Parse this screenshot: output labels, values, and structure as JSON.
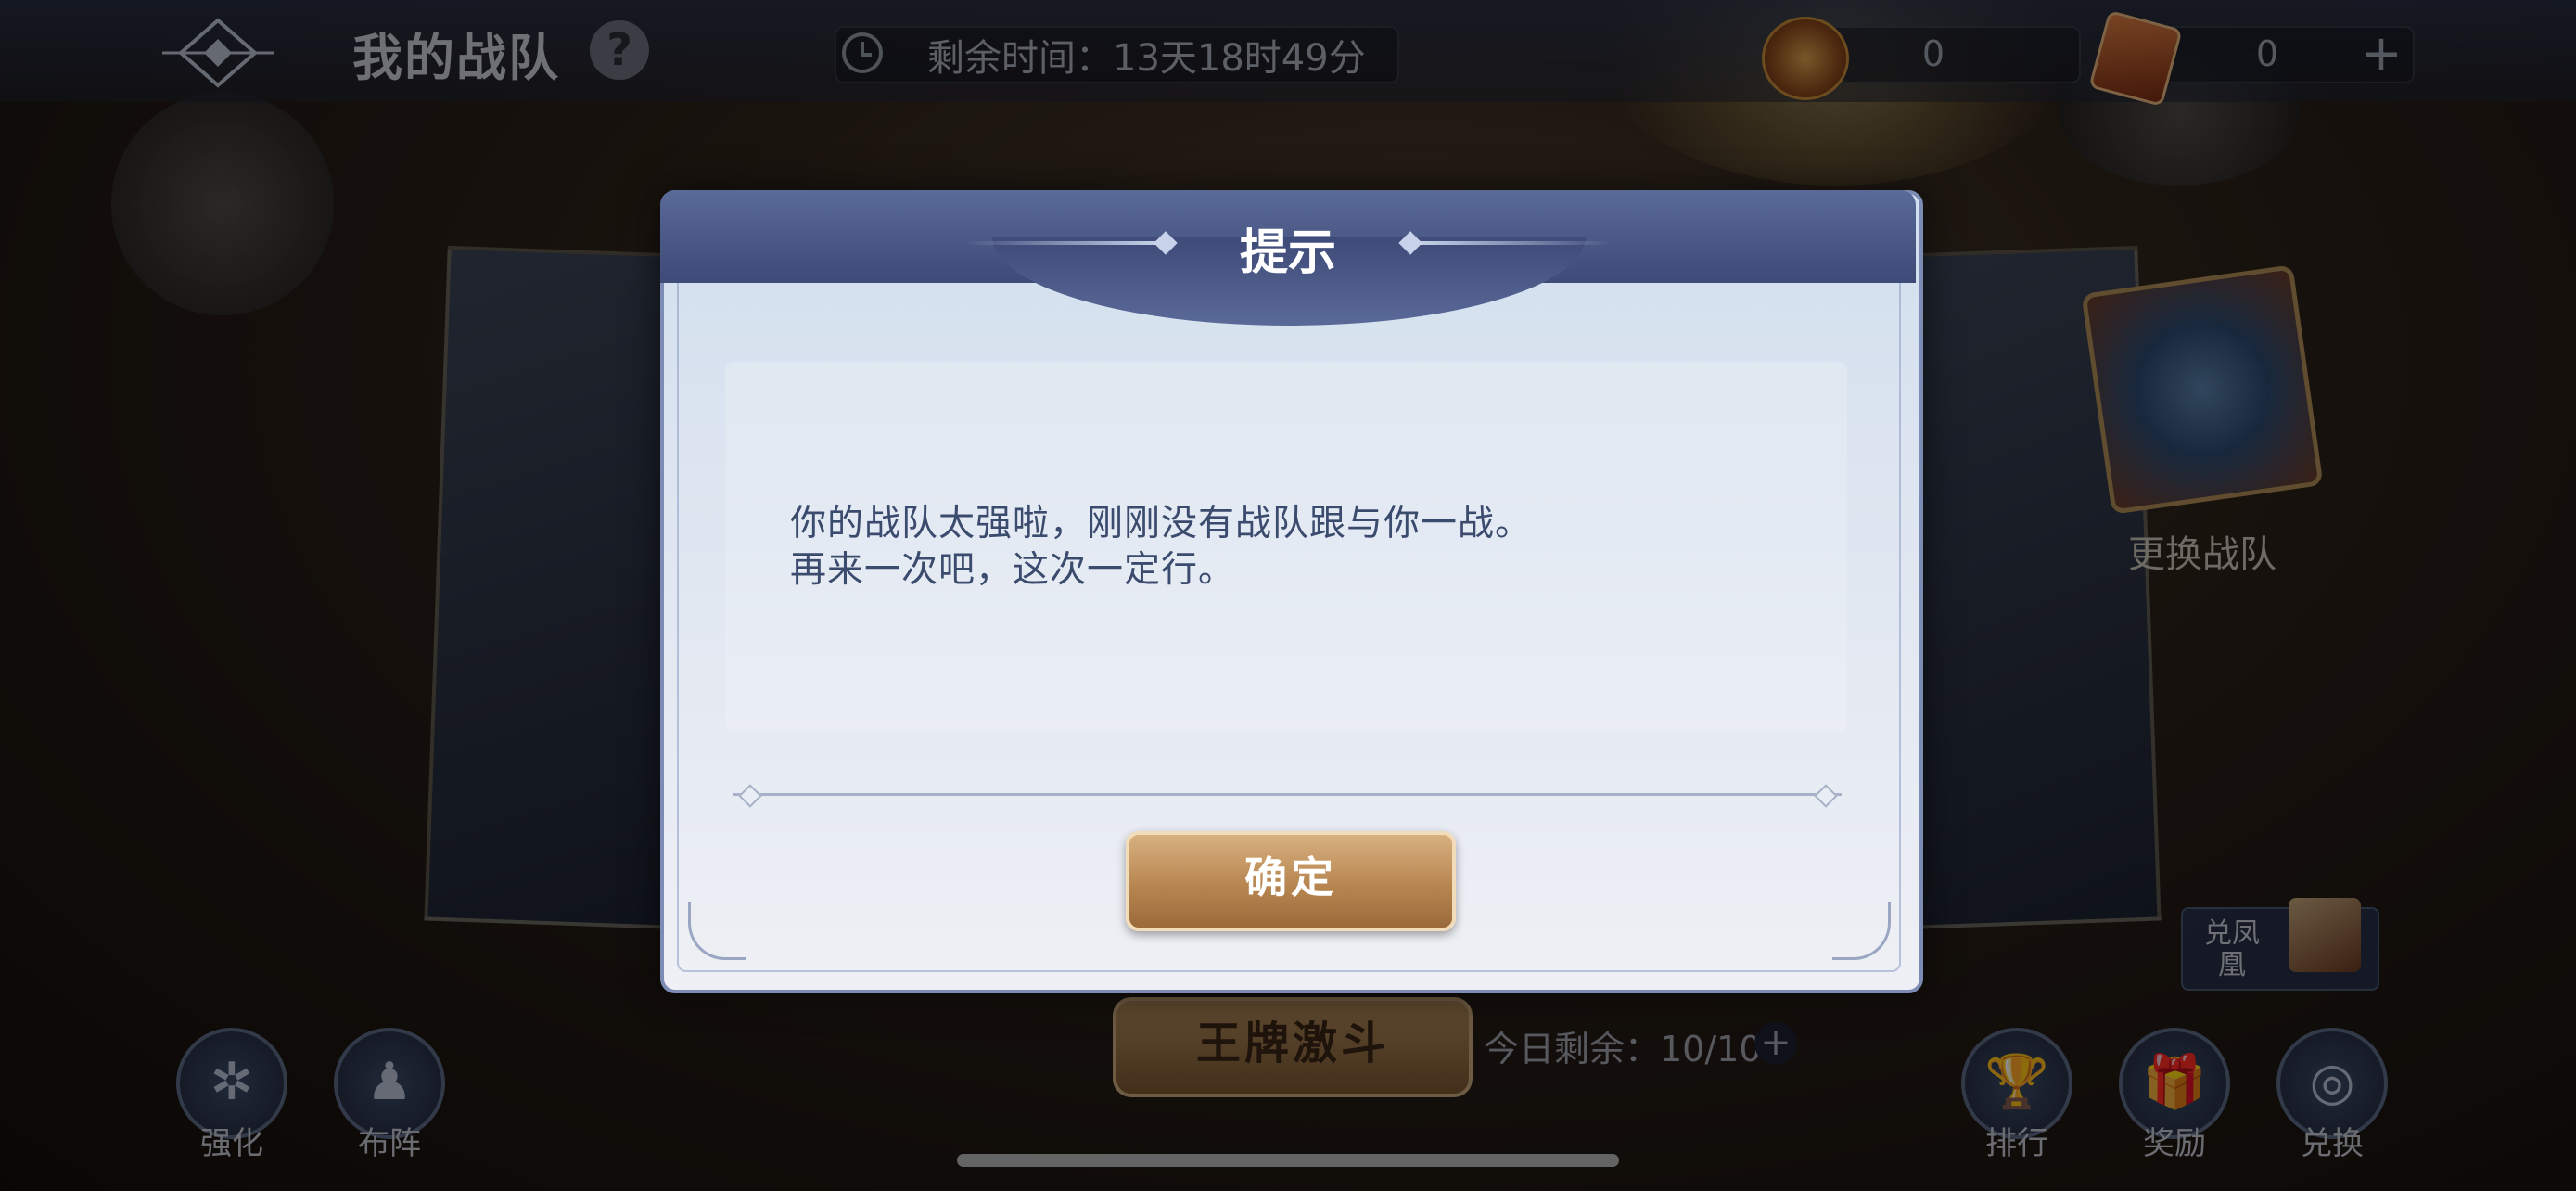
{
  "header": {
    "title": "我的战队",
    "help_icon": "question-mark-icon",
    "timer_label": "剩余时间：13天18时49分",
    "currency_1_value": "0",
    "currency_2_value": "0",
    "add_label": "+"
  },
  "sidebar_right": {
    "change_team_label": "更换战队",
    "exchange_phoenix_label": "兑凤凰"
  },
  "bottom": {
    "enhance_label": "强化",
    "formation_label": "布阵",
    "ace_battle_label": "王牌激斗",
    "remaining_today": "今日剩余：10/10",
    "add_label": "+",
    "rank_label": "排行",
    "reward_label": "奖励",
    "exchange_label": "兑换"
  },
  "dialog": {
    "title": "提示",
    "message_line1": "你的战队太强啦，刚刚没有战队跟与你一战。",
    "message_line2": "再来一次吧，这次一定行。",
    "confirm_label": "确定"
  },
  "colors": {
    "dialog_header": "#4a5884",
    "confirm_button": "#b78650",
    "message_text": "#3b4b6e"
  }
}
